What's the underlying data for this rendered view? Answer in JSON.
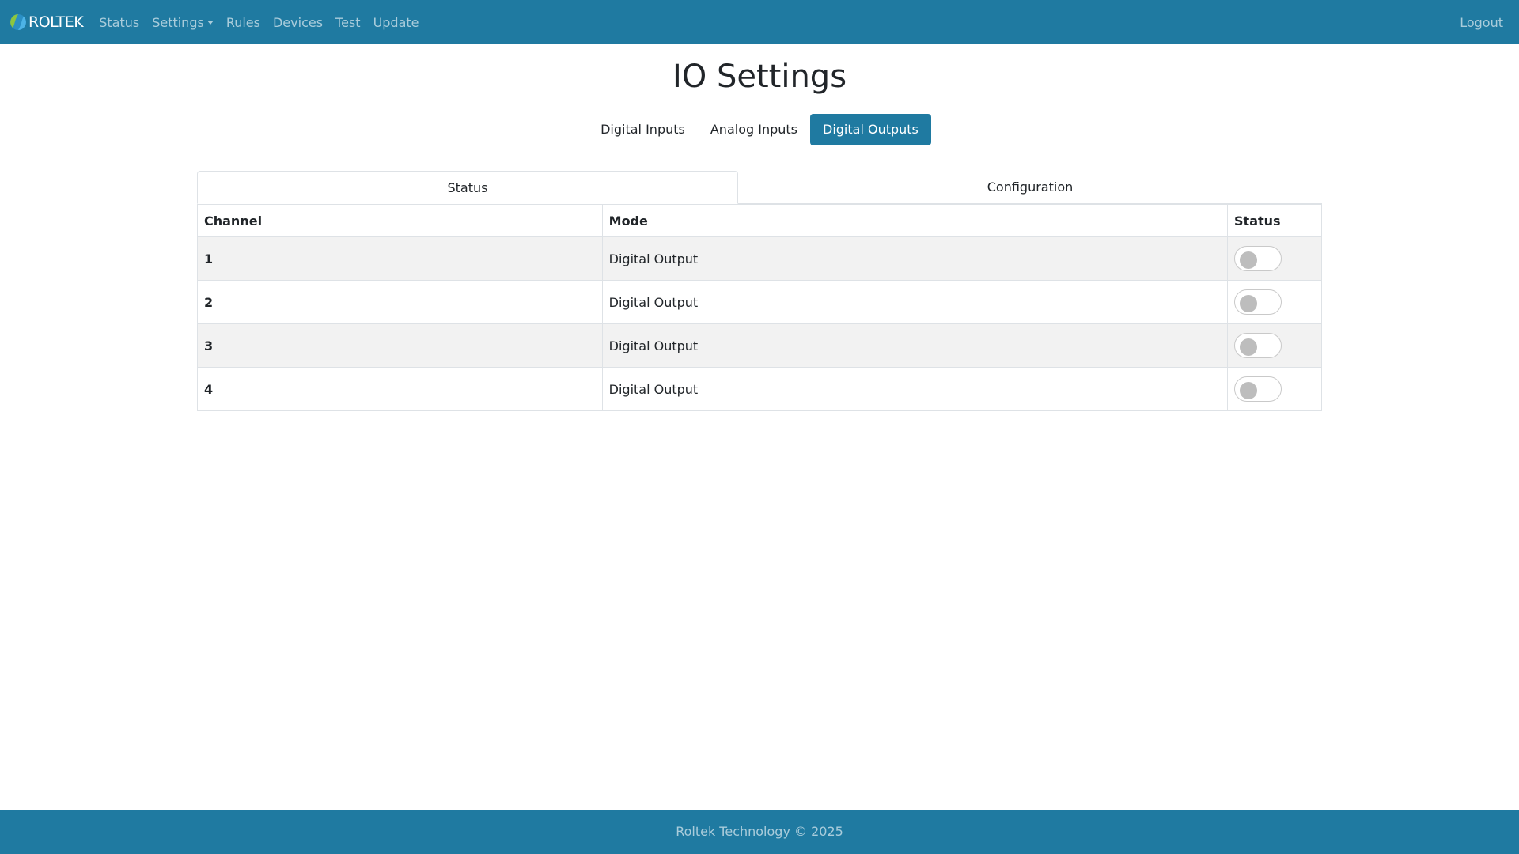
{
  "navbar": {
    "brand": "ROLTEK",
    "links": [
      {
        "label": "Status"
      },
      {
        "label": "Settings"
      },
      {
        "label": "Rules"
      },
      {
        "label": "Devices"
      },
      {
        "label": "Test"
      },
      {
        "label": "Update"
      }
    ],
    "logout": "Logout"
  },
  "page": {
    "title": "IO Settings"
  },
  "pills": [
    {
      "label": "Digital Inputs",
      "active": false
    },
    {
      "label": "Analog Inputs",
      "active": false
    },
    {
      "label": "Digital Outputs",
      "active": true
    }
  ],
  "tabs": [
    {
      "label": "Status",
      "active": true
    },
    {
      "label": "Configuration",
      "active": false
    }
  ],
  "table": {
    "headers": [
      "Channel",
      "Mode",
      "Status"
    ],
    "rows": [
      {
        "channel": "1",
        "mode": "Digital Output",
        "on": false
      },
      {
        "channel": "2",
        "mode": "Digital Output",
        "on": false
      },
      {
        "channel": "3",
        "mode": "Digital Output",
        "on": false
      },
      {
        "channel": "4",
        "mode": "Digital Output",
        "on": false
      }
    ]
  },
  "footer": {
    "text": "Roltek Technology © 2025"
  },
  "colors": {
    "primary": "#1f7aa1",
    "stripe": "#f2f2f2",
    "toggle_knob": "#bdbdbd"
  }
}
